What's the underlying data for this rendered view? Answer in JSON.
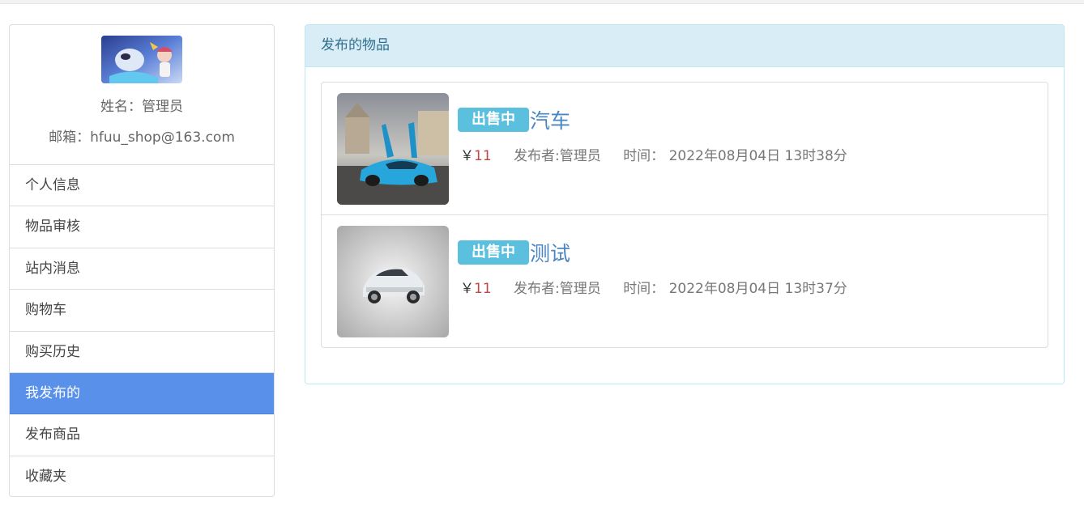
{
  "profile": {
    "name_line": "姓名：管理员",
    "email_line": "邮箱：hfuu_shop@163.com"
  },
  "menu": [
    {
      "label": "个人信息"
    },
    {
      "label": "物品审核"
    },
    {
      "label": "站内消息"
    },
    {
      "label": "购物车"
    },
    {
      "label": "购买历史"
    },
    {
      "label": "我发布的",
      "active": true
    },
    {
      "label": "发布商品"
    },
    {
      "label": "收藏夹"
    }
  ],
  "panel": {
    "heading": "发布的物品"
  },
  "items": [
    {
      "status": "出售中",
      "title": "汽车",
      "currency": "￥",
      "price": "11",
      "author": "发布者:管理员",
      "time": "时间： 2022年08月04日 13时38分"
    },
    {
      "status": "出售中",
      "title": "测试",
      "currency": "￥",
      "price": "11",
      "author": "发布者:管理员",
      "time": "时间： 2022年08月04日 13时37分"
    }
  ],
  "colors": {
    "active_menu": "#5890ea",
    "badge": "#5bc0de",
    "panel_heading_bg": "#d9edf7",
    "title_link": "#4a86c4",
    "price": "#b94a48"
  }
}
